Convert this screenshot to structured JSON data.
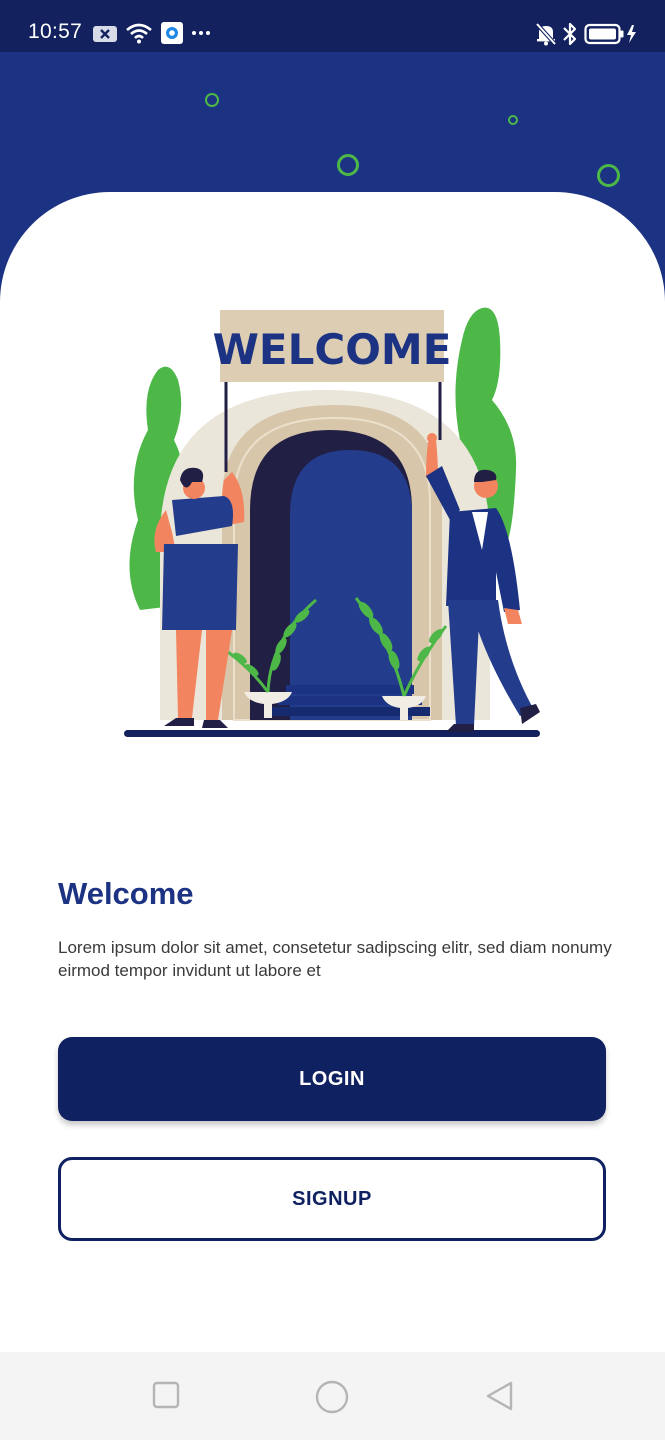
{
  "status_bar": {
    "time": "10:57",
    "left_icons": [
      "notification-x-icon",
      "wifi-icon",
      "app-badge-icon",
      "more-dots-icon"
    ],
    "right_icons": [
      "bell-muted-icon",
      "bluetooth-icon",
      "battery-charging-icon"
    ]
  },
  "illustration": {
    "sign_text": "WELCOME"
  },
  "welcome": {
    "title": "Welcome",
    "description": "Lorem ipsum dolor sit amet, consetetur sadipscing elitr, sed diam nonumy eirmod tempor invidunt ut labore et"
  },
  "buttons": {
    "login_label": "LOGIN",
    "signup_label": "SIGNUP"
  },
  "nav_bar": {
    "icons": [
      "recent-apps-icon",
      "home-icon",
      "back-icon"
    ]
  },
  "colors": {
    "primary": "#1c3282",
    "button_dark": "#0f2160",
    "accent_green": "#4db848",
    "status_bar": "#13215e"
  }
}
